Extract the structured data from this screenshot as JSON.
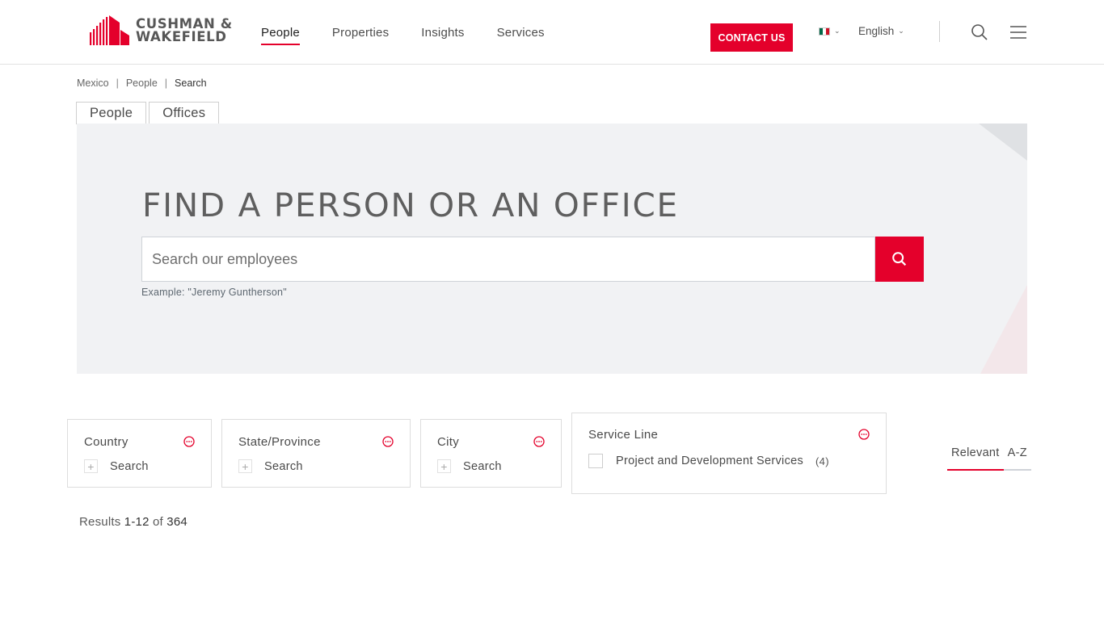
{
  "header": {
    "logo_line1": "CUSHMAN &",
    "logo_line2": "WAKEFIELD",
    "nav": [
      {
        "label": "People",
        "active": true
      },
      {
        "label": "Properties",
        "active": false
      },
      {
        "label": "Insights",
        "active": false
      },
      {
        "label": "Services",
        "active": false
      }
    ],
    "contact_label": "CONTACT US",
    "language": "English",
    "icons": {
      "flag": "mexico-flag-icon",
      "search": "search-icon",
      "menu": "hamburger-menu-icon",
      "chevron": "chevron-down-icon"
    }
  },
  "colors": {
    "brand": "#e4002b",
    "hero_bg": "#f1f2f4"
  },
  "breadcrumb": [
    "Mexico",
    "People",
    "Search"
  ],
  "tabs": [
    "People",
    "Offices"
  ],
  "hero": {
    "title": "FIND A PERSON OR AN OFFICE",
    "search_placeholder": "Search our employees",
    "search_value": "",
    "example": "Example: \"Jeremy Guntherson\""
  },
  "filters": {
    "country": {
      "title": "Country",
      "search_label": "Search"
    },
    "state": {
      "title": "State/Province",
      "search_label": "Search"
    },
    "city": {
      "title": "City",
      "search_label": "Search"
    },
    "service_line": {
      "title": "Service Line",
      "options": [
        {
          "label": "Project and Development Services",
          "count": "(4)",
          "checked": false
        }
      ]
    }
  },
  "sort": [
    {
      "label": "Relevant",
      "active": true
    },
    {
      "label": "A-Z",
      "active": false
    }
  ],
  "results": {
    "prefix": "Results",
    "range": "1-12",
    "of": "of",
    "total": "364"
  }
}
